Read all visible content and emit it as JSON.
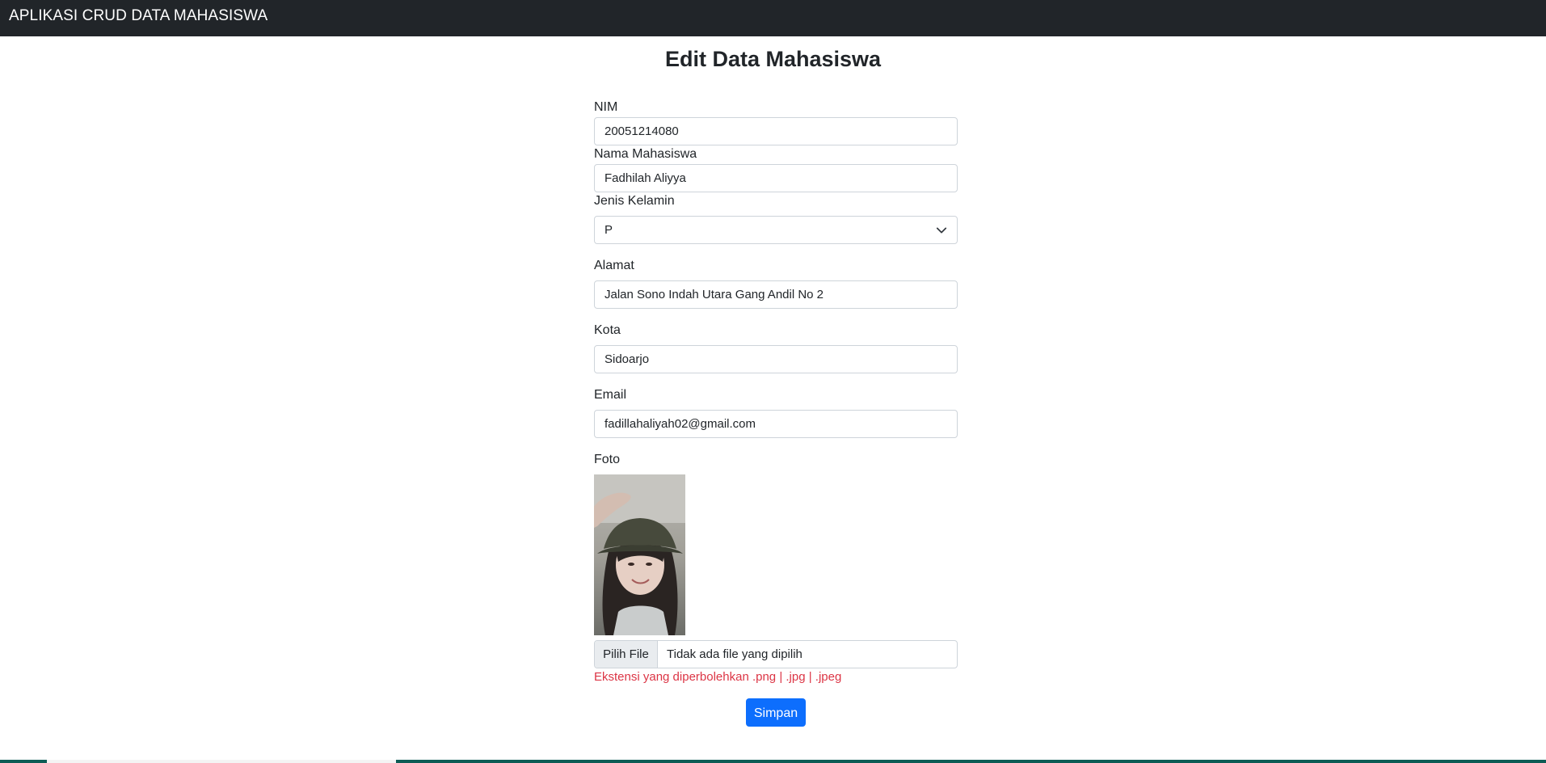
{
  "navbar": {
    "brand": "APLIKASI CRUD DATA MAHASISWA"
  },
  "page": {
    "title": "Edit Data Mahasiswa"
  },
  "form": {
    "nim": {
      "label": "NIM",
      "value": "20051214080"
    },
    "nama": {
      "label": "Nama Mahasiswa",
      "value": "Fadhilah Aliyya"
    },
    "jenis_kelamin": {
      "label": "Jenis Kelamin",
      "selected": "P"
    },
    "alamat": {
      "label": "Alamat",
      "value": "Jalan Sono Indah Utara Gang Andil No 2"
    },
    "kota": {
      "label": "Kota",
      "value": "Sidoarjo"
    },
    "email": {
      "label": "Email",
      "value": "fadillahaliyah02@gmail.com"
    },
    "foto": {
      "label": "Foto",
      "file_button": "Pilih File",
      "file_status": "Tidak ada file yang dipilih",
      "hint": "Ekstensi yang diperbolehkan .png | .jpg | .jpeg"
    },
    "submit_label": "Simpan"
  },
  "colors": {
    "navbar_bg": "#212529",
    "primary": "#0d6efd",
    "danger": "#dc3545",
    "border": "#ced4da"
  }
}
